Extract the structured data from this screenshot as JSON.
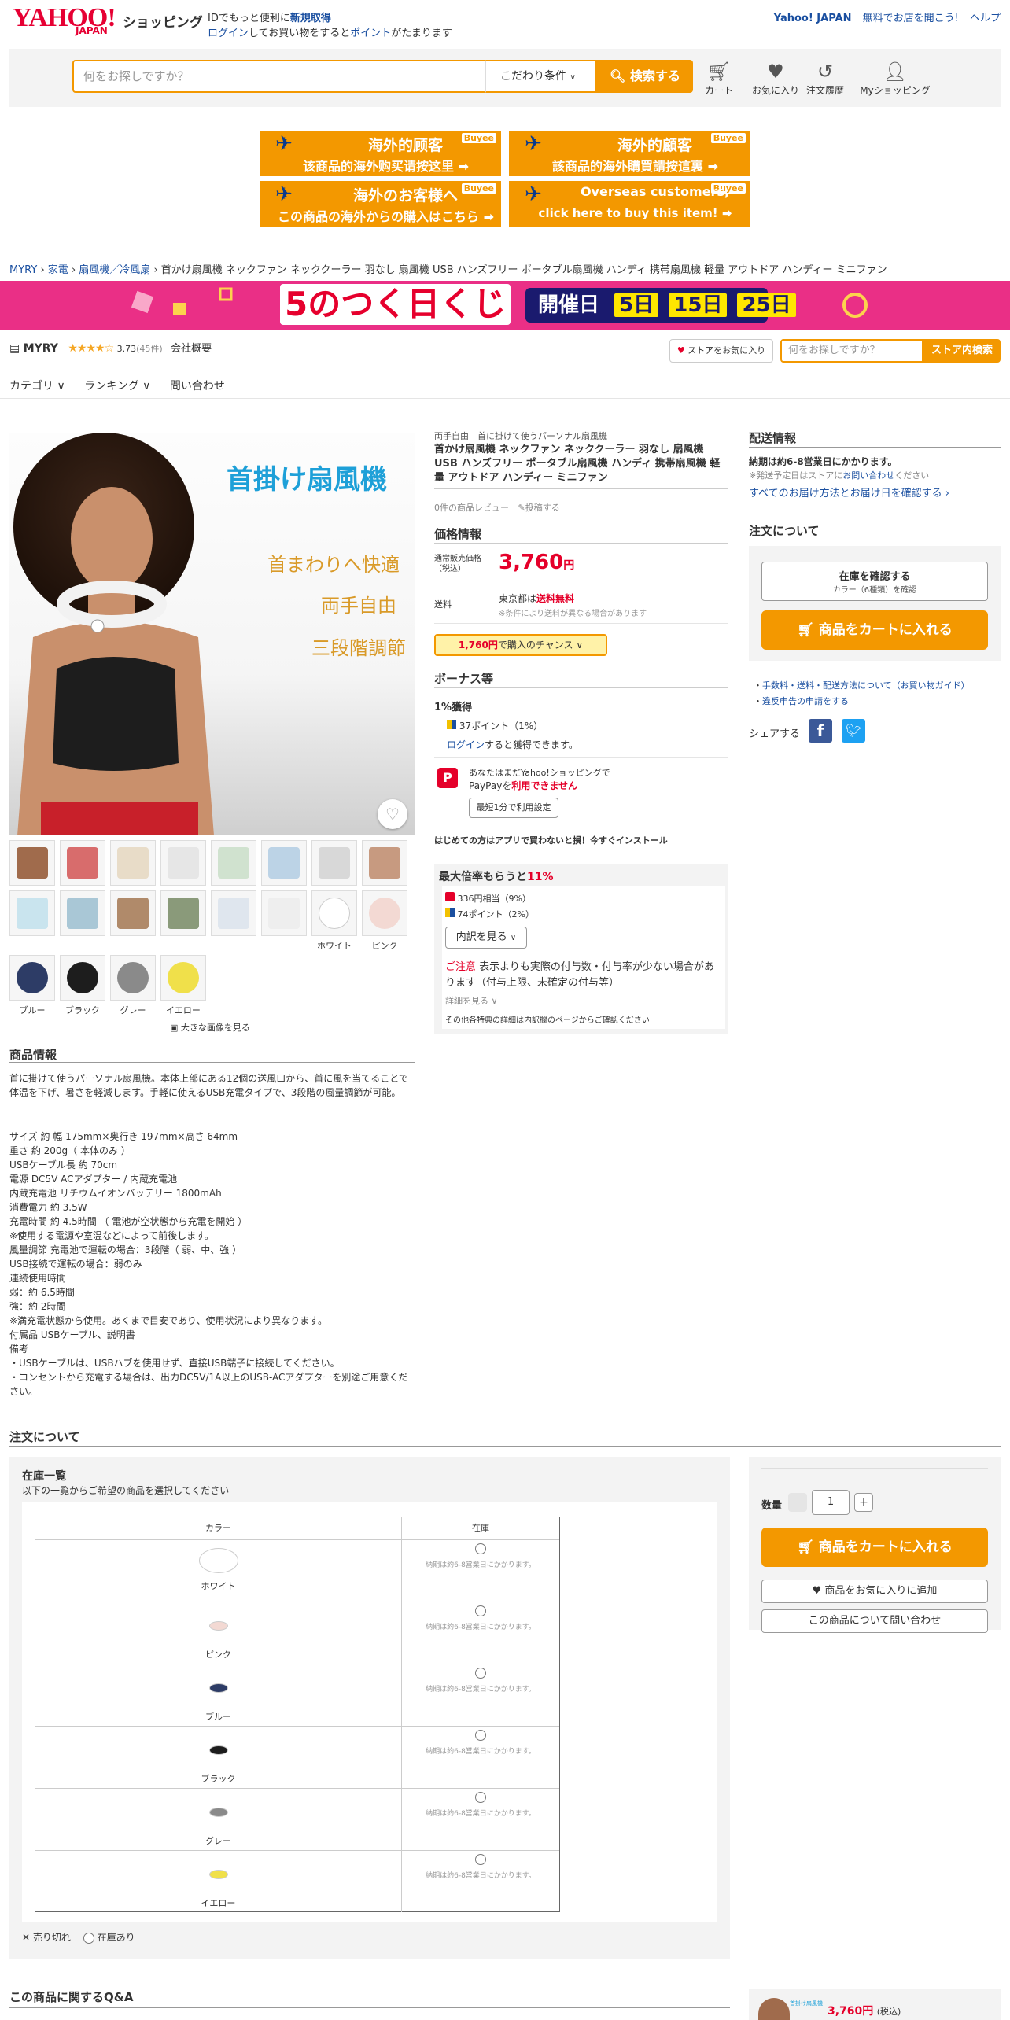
{
  "header": {
    "logo": "YAHOO!",
    "logo_sub": "JAPAN",
    "logo_shop": "ショッピング",
    "msg1_pre": "IDでもっと便利に",
    "msg1_link": "新規取得",
    "msg2_link1": "ログイン",
    "msg2_mid": "してお買い物をすると",
    "msg2_link2": "ポイント",
    "msg2_post": "がたまります",
    "yahoo_japan": "Yahoo! JAPAN",
    "open_store": "無料でお店を開こう!",
    "help": "ヘルプ"
  },
  "search": {
    "placeholder": "何をお探しですか？",
    "condition": "こだわり条件",
    "button": "検索する",
    "icons": [
      {
        "label": "カート",
        "icon": "cart-icon"
      },
      {
        "label": "お気に入り",
        "icon": "heart-icon"
      },
      {
        "label": "注文履歴",
        "icon": "history-icon"
      },
      {
        "label": "Myショッピング",
        "icon": "user-icon"
      }
    ]
  },
  "banners": [
    {
      "t1": "海外的顾客",
      "t2": "该商品的海外购买请按这里 ➡",
      "tag": "Buyee"
    },
    {
      "t1": "海外的顧客",
      "t2": "該商品的海外購買請按這裏 ➡",
      "tag": "Buyee"
    },
    {
      "t1": "海外のお客様へ",
      "t2": "この商品の海外からの購入はこちら ➡",
      "tag": "Buyee"
    },
    {
      "t1": "Overseas customers,",
      "t2": "click here to buy this item! ➡",
      "tag": "Buyee"
    }
  ],
  "breadcrumb": {
    "items": [
      "MYRY",
      "家電",
      "扇風機／冷風扇"
    ],
    "current": "首かけ扇風機 ネックファン ネッククーラー 羽なし 扇風機 USB ハンズフリー ポータブル扇風機 ハンディ 携帯扇風機 軽量 アウトドア ハンディー ミニファン"
  },
  "kuji": {
    "title": "5のつく日くじ",
    "days_label": "開催日",
    "days": [
      "5日",
      "15日",
      "25日"
    ]
  },
  "store": {
    "name": "MYRY",
    "rating": "3.73",
    "reviews": "45件",
    "overview": "会社概要",
    "fav_button": "ストアをお気に入り",
    "search_placeholder": "何をお探しですか？",
    "search_button": "ストア内検索",
    "nav": [
      "カテゴリ ∨",
      "ランキング ∨",
      "問い合わせ"
    ]
  },
  "main_image": {
    "title": "首掛け扇風機",
    "lines": [
      "首まわりへ快適",
      "両手自由",
      "三段階調節"
    ]
  },
  "variants": {
    "row2_labels": [
      "ホワイト",
      "ピンク"
    ],
    "row3_labels": [
      "ブルー",
      "ブラック",
      "グレー",
      "イエロー"
    ],
    "large_image": "大きな画像を見る"
  },
  "product": {
    "subtitle": "両手自由　首に掛けて使うパーソナル扇風機",
    "title": "首かけ扇風機 ネックファン ネッククーラー 羽なし 扇風機 USB ハンズフリー ポータブル扇風機 ハンディ 携帯扇風機 軽量 アウトドア ハンディー ミニファン",
    "review_count": "0件の商品レビュー",
    "post_review": "投稿する",
    "price_heading": "価格情報",
    "price_label": "通常販売価格（税込）",
    "price": "3,760",
    "price_unit": "円",
    "shipping_label": "送料",
    "shipping_pre": "東京都は",
    "shipping_free": "送料無料",
    "shipping_note": "※条件により送料が異なる場合があります",
    "chance_price": "1,760円",
    "chance_text": "で購入のチャンス",
    "bonus_heading": "ボーナス等",
    "bonus_pct": "1%獲得",
    "bonus_points": "37ポイント（1%）",
    "bonus_login": "ログイン",
    "bonus_login_post": "すると獲得できます。",
    "paypay_line1": "あなたはまだYahoo!ショッピングで",
    "paypay_line2_pre": "PayPayを",
    "paypay_line2_red": "利用できません",
    "paypay_btn": "最短1分で利用設定",
    "app_notice": "はじめての方はアプリで買わないと損！今すぐインストール",
    "max_pre": "最大倍率もらうと",
    "max_pct": "11%",
    "max_line1": "336円相当（9%）",
    "max_line2": "74ポイント（2%）",
    "breakdown_btn": "内訳を見る",
    "caution_red": "ご注意",
    "caution_text": "表示よりも実際の付与数・付与率が少ない場合があります（付与上限、未確定の付与等）",
    "details": "詳細を見る",
    "other": "その他各特典の詳細は内訳欄のページからご確認ください"
  },
  "right": {
    "delivery_heading": "配送情報",
    "delivery_line": "納期は約6-8営業日にかかります。",
    "delivery_note_pre": "※発送予定日はストアに",
    "delivery_note_link": "お問い合わせ",
    "delivery_note_post": "ください",
    "delivery_link": "すべてのお届け方法とお届け日を確認する",
    "order_heading": "注文について",
    "stock_btn": "在庫を確認する",
    "stock_btn_sub": "カラー（6種類）を確認",
    "cart_btn": "商品をカートに入れる",
    "links": [
      "手数料・送料・配送方法について（お買い物ガイド）",
      "違反申告の申請をする"
    ],
    "share": "シェアする"
  },
  "product_info": {
    "heading": "商品情報",
    "desc": "首に掛けて使うパーソナル扇風機。本体上部にある12個の送風口から、首に風を当てることで体温を下げ、暑さを軽減します。手軽に使えるUSB充電タイプで、3段階の風量調節が可能。",
    "specs": [
      "サイズ 約 幅 175mm×奥行き 197mm×高さ 64mm",
      "重さ 約 200g（ 本体のみ ）",
      "USBケーブル長 約 70cm",
      "電源 DC5V ACアダプター / 内蔵充電池",
      "内蔵充電池 リチウムイオンバッテリー 1800mAh",
      "消費電力 約 3.5W",
      "充電時間 約 4.5時間 （ 電池が空状態から充電を開始 ）",
      "※使用する電源や室温などによって前後します。",
      "風量調節 充電池で運転の場合：3段階（ 弱、中、強 ）",
      "USB接続で運転の場合：弱のみ",
      "連続使用時間",
      "弱：約 6.5時間",
      "強：約 2時間",
      "※満充電状態から使用。あくまで目安であり、使用状況により異なります。",
      "付属品 USBケーブル、説明書",
      "備考",
      "・USBケーブルは、USBハブを使用せず、直接USB端子に接続してください。",
      "・コンセントから充電する場合は、出力DC5V/1A以上のUSB-ACアダプターを別途ご用意ください。"
    ]
  },
  "order": {
    "heading": "注文について",
    "stock_title": "在庫一覧",
    "stock_sub": "以下の一覧からご希望の商品を選択してください",
    "col_color": "カラー",
    "col_stock": "在庫",
    "rows": [
      {
        "color": "ホワイト",
        "note": "納期は約6-8営業日にかかります。"
      },
      {
        "color": "ピンク",
        "note": "納期は約6-8営業日にかかります。"
      },
      {
        "color": "ブルー",
        "note": "納期は約6-8営業日にかかります。"
      },
      {
        "color": "ブラック",
        "note": "納期は約6-8営業日にかかります。"
      },
      {
        "color": "グレー",
        "note": "納期は約6-8営業日にかかります。"
      },
      {
        "color": "イエロー",
        "note": "納期は約6-8営業日にかかります。"
      }
    ],
    "legend_soldout": "売り切れ",
    "legend_instock": "在庫あり",
    "qty_label": "数量",
    "qty_value": "1",
    "plus": "+",
    "cart_btn": "商品をカートに入れる",
    "fav_btn": "商品をお気に入りに追加",
    "ask_btn": "この商品について問い合わせ"
  },
  "qa": {
    "heading": "この商品に関するQ&A",
    "mini_price": "3,760円",
    "mini_tax": "(税込)",
    "mini_label": "首掛け扇風機"
  },
  "colors": {
    "accent": "#f39800",
    "price_red": "#e5002a",
    "link_blue": "#1a4fa0",
    "kuji_pink": "#ea2f86"
  }
}
